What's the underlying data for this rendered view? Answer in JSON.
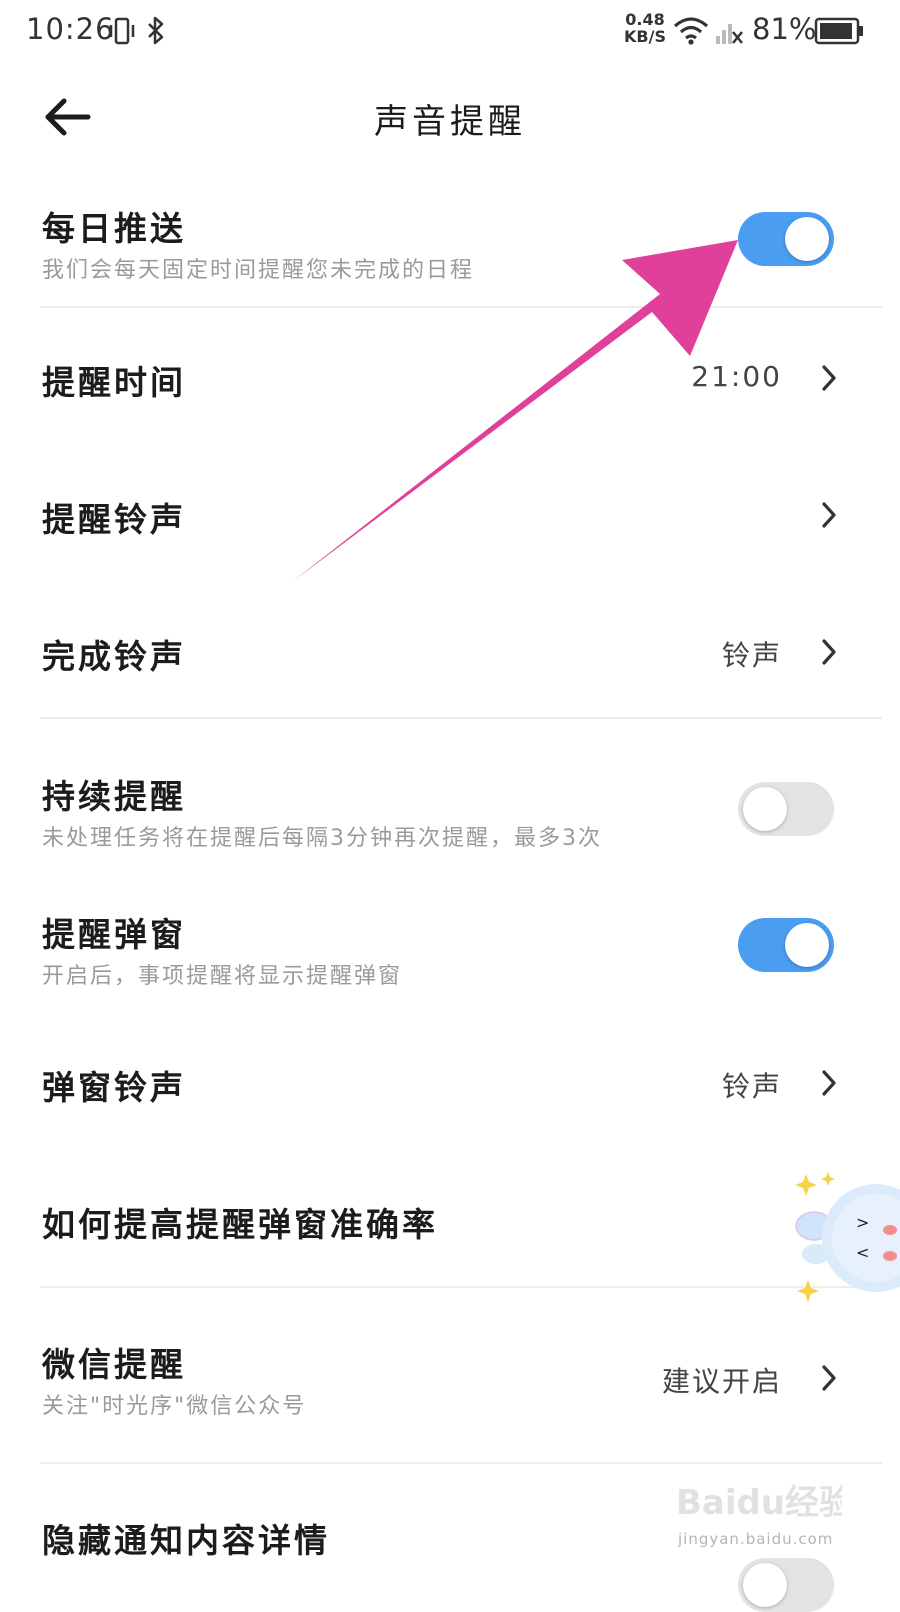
{
  "status_bar": {
    "time": "10:26",
    "net_speed_value": "0.48",
    "net_speed_unit": "KB/S",
    "battery": "81%"
  },
  "header": {
    "title": "声音提醒"
  },
  "settings": {
    "daily_push": {
      "title": "每日推送",
      "subtitle": "我们会每天固定时间提醒您未完成的日程",
      "enabled": true
    },
    "remind_time": {
      "title": "提醒时间",
      "value": "21:00"
    },
    "remind_ringtone": {
      "title": "提醒铃声"
    },
    "complete_ringtone": {
      "title": "完成铃声",
      "value": "铃声"
    },
    "persistent_remind": {
      "title": "持续提醒",
      "subtitle": "未处理任务将在提醒后每隔3分钟再次提醒，最多3次",
      "enabled": false
    },
    "remind_popup": {
      "title": "提醒弹窗",
      "subtitle": "开启后，事项提醒将显示提醒弹窗",
      "enabled": true
    },
    "popup_ringtone": {
      "title": "弹窗铃声",
      "value": "铃声"
    },
    "popup_accuracy": {
      "title": "如何提高提醒弹窗准确率"
    },
    "wechat_remind": {
      "title": "微信提醒",
      "subtitle": "关注\"时光序\"微信公众号",
      "value": "建议开启"
    },
    "hide_details": {
      "title": "隐藏通知内容详情"
    }
  },
  "watermark": {
    "brand": "Baidu经验",
    "url": "jingyan.baidu.com"
  },
  "colors": {
    "toggle_on": "#4a9df0",
    "toggle_off": "#e3e3e3",
    "annotation_arrow": "#e0409a"
  }
}
